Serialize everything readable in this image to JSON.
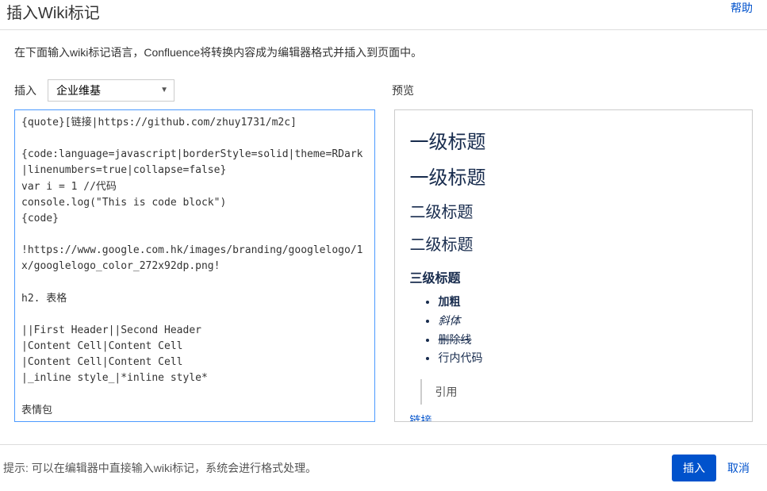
{
  "dialog": {
    "title": "插入Wiki标记",
    "help": "帮助",
    "description": "在下面输入wiki标记语言，Confluence将转换内容成为编辑器格式并插入到页面中。"
  },
  "controls": {
    "insert_label": "插入",
    "type_selected": "企业维基",
    "preview_label": "预览"
  },
  "markup": {
    "value": "{quote}[链接|https://github.com/zhuy1731/m2c]\n\n{code:language=javascript|borderStyle=solid|theme=RDark|linenumbers=true|collapse=false}\nvar i = 1 //代码\nconsole.log(\"This is code block\")\n{code}\n\n!https://www.google.com.hk/images/branding/googlelogo/1x/googlelogo_color_272x92dp.png!\n\nh2. 表格\n\n||First Header||Second Header\n|Content Cell|Content Cell\n|Content Cell|Content Cell\n|_inline style_|*inline style*\n\n表情包\n:)"
  },
  "preview": {
    "h1_a": "一级标题",
    "h1_b": "一级标题",
    "h2_a": "二级标题",
    "h2_b": "二级标题",
    "h3": "三级标题",
    "li_bold": "加粗",
    "li_italic": "斜体",
    "li_strike": "删除线",
    "li_code": "行内代码",
    "quote": "引用",
    "link": "链接"
  },
  "footer": {
    "hint": "提示: 可以在编辑器中直接输入wiki标记，系统会进行格式处理。",
    "insert": "插入",
    "cancel": "取消"
  }
}
